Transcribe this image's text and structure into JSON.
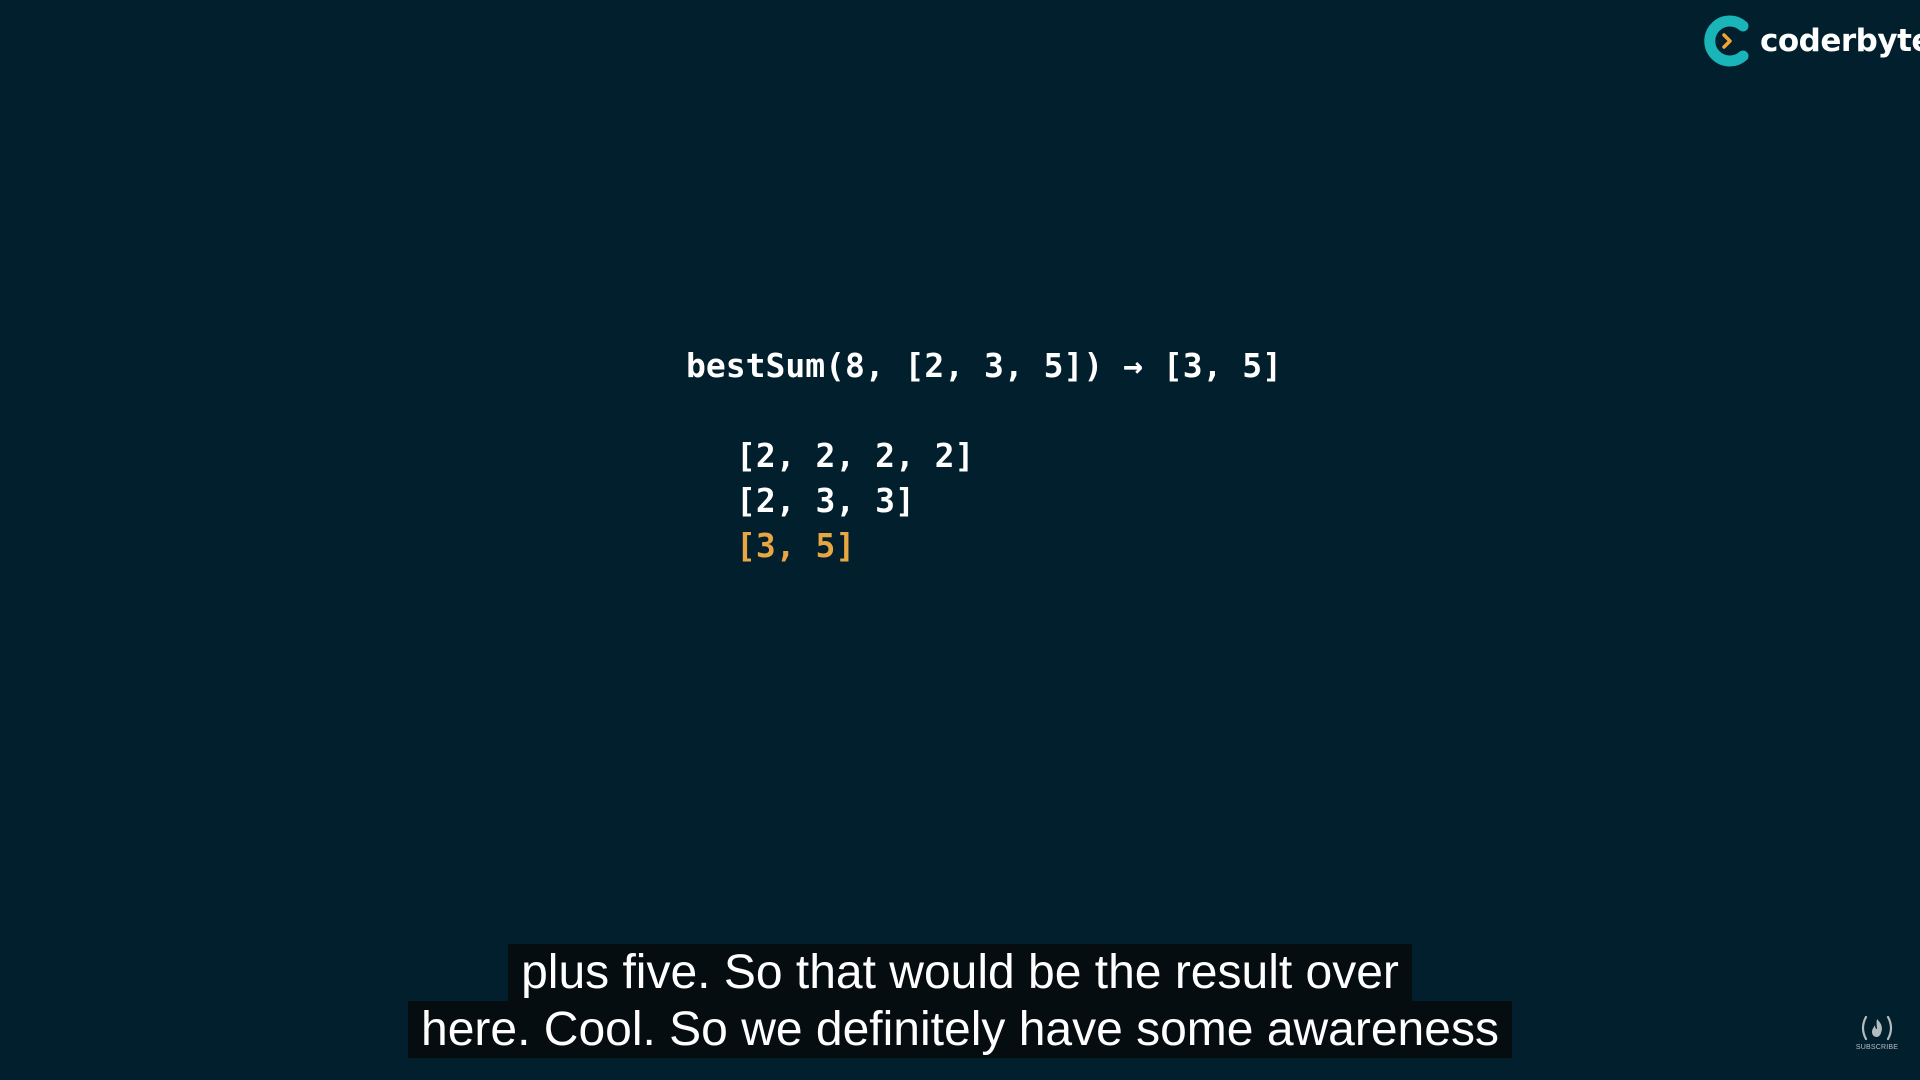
{
  "brand": {
    "name": "coderbyte",
    "mark_icon": "coderbyte-logo-icon",
    "colors": {
      "teal": "#1ab5b9",
      "chevron": "#f0a634",
      "text": "#ffffff"
    }
  },
  "slide": {
    "background": "#011f2d",
    "call_line": "bestSum(8, [2, 3, 5]) → [3, 5]",
    "combinations": [
      "[2, 2, 2, 2]",
      "[2, 3, 3]",
      "[3, 5]"
    ],
    "highlight_color": "#e9a744"
  },
  "captions": {
    "lines": [
      "plus five. So that would be the result over",
      "here. Cool. So we definitely have some awareness"
    ]
  },
  "watermark": {
    "icon": "freecodecamp-flame-icon",
    "label": "SUBSCRIBE"
  }
}
